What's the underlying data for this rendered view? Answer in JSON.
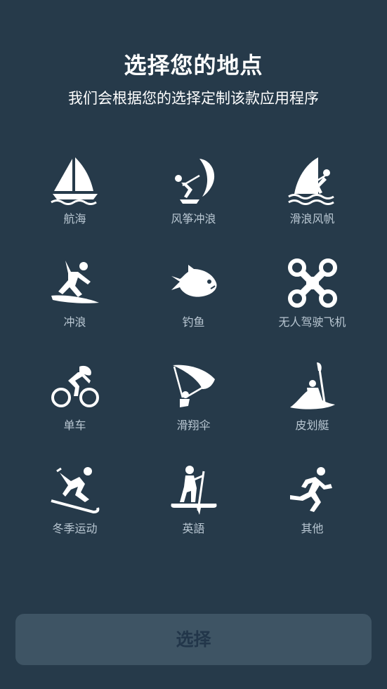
{
  "header": {
    "title": "选择您的地点",
    "subtitle": "我们会根据您的选择定制该款应用程序"
  },
  "activities": [
    {
      "label": "航海",
      "icon": "sailboat-icon"
    },
    {
      "label": "风筝冲浪",
      "icon": "kitesurfing-icon"
    },
    {
      "label": "滑浪风帆",
      "icon": "windsurfing-icon"
    },
    {
      "label": "冲浪",
      "icon": "surfing-icon"
    },
    {
      "label": "钓鱼",
      "icon": "fish-icon"
    },
    {
      "label": "无人驾驶飞机",
      "icon": "drone-icon"
    },
    {
      "label": "单车",
      "icon": "cycling-icon"
    },
    {
      "label": "滑翔伞",
      "icon": "paragliding-icon"
    },
    {
      "label": "皮划艇",
      "icon": "kayaking-icon"
    },
    {
      "label": "冬季运动",
      "icon": "skiing-icon"
    },
    {
      "label": "英語",
      "icon": "paddleboard-icon"
    },
    {
      "label": "其他",
      "icon": "running-icon"
    }
  ],
  "footer": {
    "select_label": "选择"
  },
  "colors": {
    "background": "#263a4a",
    "button": "#3e5464",
    "label": "#b9c7d2"
  }
}
